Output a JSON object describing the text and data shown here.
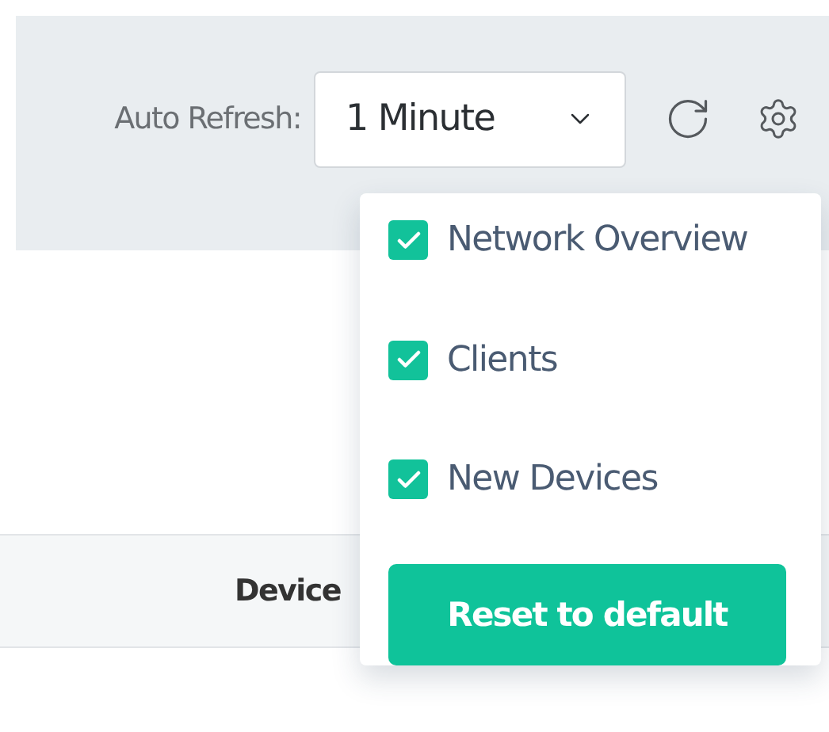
{
  "toolbar": {
    "label": "Auto Refresh:",
    "interval": "1 Minute"
  },
  "table": {
    "columns": [
      "Device"
    ]
  },
  "settings_menu": {
    "items": [
      {
        "label": "Network Overview",
        "checked": true
      },
      {
        "label": "Clients",
        "checked": true
      },
      {
        "label": "New Devices",
        "checked": true
      }
    ],
    "reset_button": "Reset to default"
  }
}
